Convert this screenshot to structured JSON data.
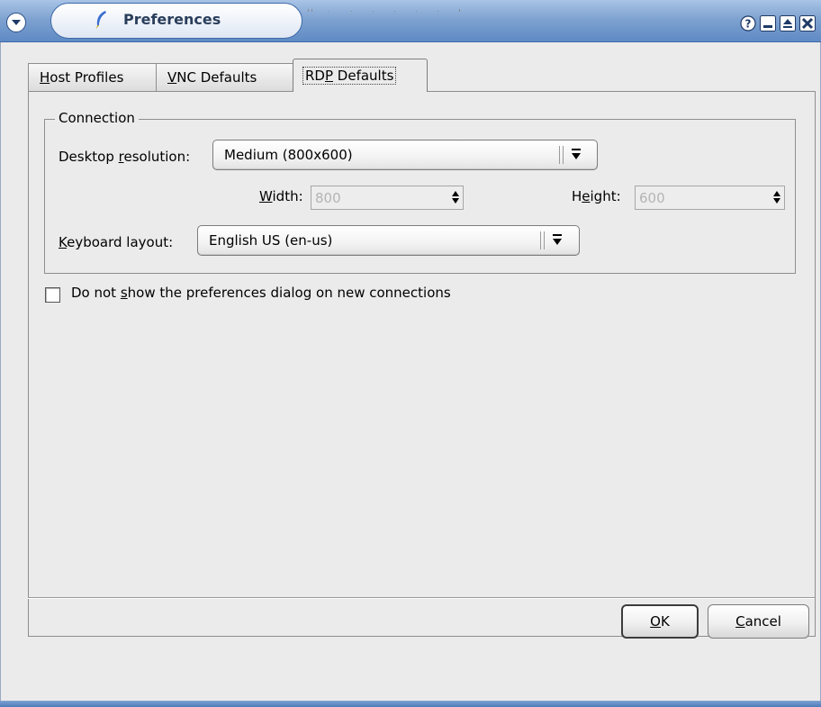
{
  "window": {
    "title": "Preferences"
  },
  "icons": {
    "menu": "chevron-down-circle-icon",
    "app": "pencil-feather-icon",
    "help": "help-icon",
    "minimize": "minimize-icon",
    "maximize": "maximize-icon",
    "close": "close-icon"
  },
  "tabs": [
    {
      "pre": "",
      "u": "H",
      "post": "ost Profiles"
    },
    {
      "pre": "",
      "u": "V",
      "post": "NC Defaults"
    },
    {
      "pre": "RD",
      "u": "P",
      "post": " Defaults",
      "selected": true
    }
  ],
  "connection": {
    "legend": "Connection",
    "resolution_label": {
      "pre": "Desktop ",
      "u": "r",
      "post": "esolution:"
    },
    "resolution_value": "Medium (800x600)",
    "width_label": {
      "pre": "",
      "u": "W",
      "post": "idth:"
    },
    "width_value": "800",
    "height_label": {
      "pre": "H",
      "u": "e",
      "post": "ight:"
    },
    "height_value": "600",
    "keyboard_label": {
      "pre": "",
      "u": "K",
      "post": "eyboard layout:"
    },
    "keyboard_value": "English US (en-us)"
  },
  "checkbox": {
    "label": {
      "pre": "Do not ",
      "u": "s",
      "post": "how the preferences dialog on new connections"
    },
    "checked": false
  },
  "buttons": {
    "ok": {
      "pre": "",
      "u": "O",
      "post": "K"
    },
    "cancel": {
      "pre": "",
      "u": "C",
      "post": "ancel"
    }
  },
  "colors": {
    "titlebar": "#7fa3d1",
    "dialog_bg": "#ebebeb"
  }
}
